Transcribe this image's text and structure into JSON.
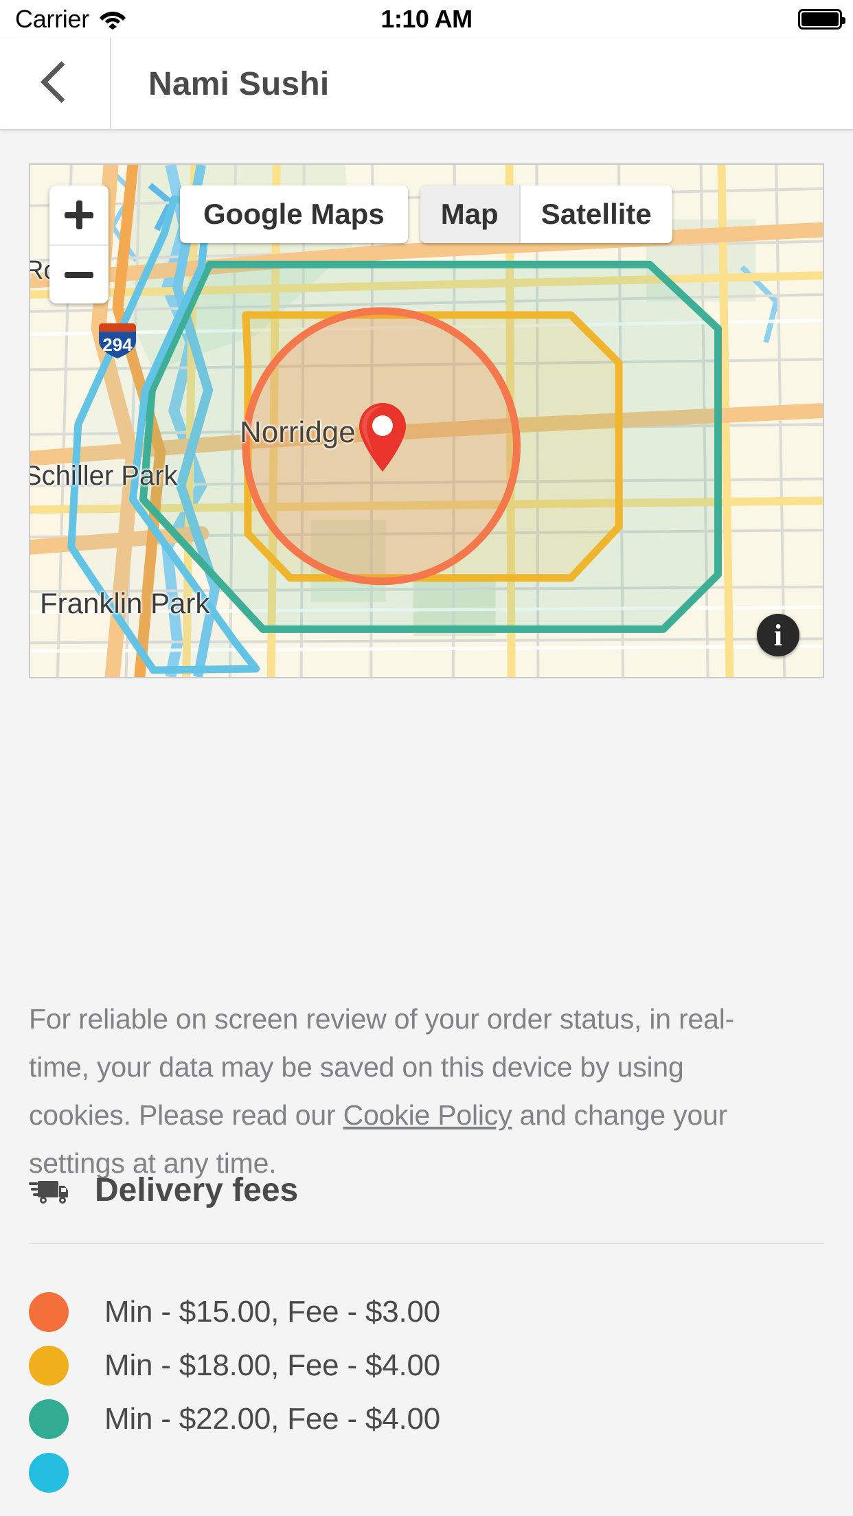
{
  "status_bar": {
    "carrier": "Carrier",
    "wifi_icon": "wifi-icon",
    "time": "1:10 AM",
    "battery_icon": "battery-full-icon"
  },
  "nav": {
    "back_icon": "chevron-left-icon",
    "title": "Nami Sushi"
  },
  "map": {
    "zoom_in_label": "+",
    "zoom_out_label": "−",
    "google_maps_button": "Google Maps",
    "type_buttons": [
      {
        "label": "Map",
        "active": true
      },
      {
        "label": "Satellite",
        "active": false
      }
    ],
    "info_button": "i",
    "marker_icon": "map-pin-icon",
    "highway_shield": "294",
    "labels": [
      {
        "name": "Rosemont",
        "text": "Ro…nt"
      },
      {
        "name": "Norridge",
        "text": "Norridge"
      },
      {
        "name": "Schiller Park",
        "text": "Schiller Park"
      },
      {
        "name": "Franklin Park",
        "text": "Franklin Park"
      }
    ],
    "zone_colors": {
      "orange": "#f4784b",
      "yellow": "#f0b429",
      "teal": "#3fae96",
      "blue": "#4fbfe0"
    }
  },
  "cookie_notice": {
    "part1": "For reliable on screen review of your order status, in real-time, your data may be saved on this device by using cookies. Please read our ",
    "link": "Cookie Policy",
    "part2": " and change your settings at any time."
  },
  "delivery_fees": {
    "icon": "delivery-truck-icon",
    "title": "Delivery fees",
    "items": [
      {
        "color": "#f4703a",
        "label": "Min - $15.00, Fee - $3.00"
      },
      {
        "color": "#f0b01e",
        "label": "Min - $18.00, Fee - $4.00"
      },
      {
        "color": "#31ab92",
        "label": "Min - $22.00, Fee - $4.00"
      },
      {
        "color": "#25bde0",
        "label": ""
      }
    ]
  }
}
